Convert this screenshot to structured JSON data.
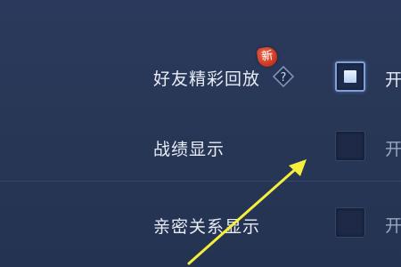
{
  "settings": {
    "rows": [
      {
        "label": "好友精彩回放",
        "checked": true,
        "option_label": "开"
      },
      {
        "label": "战绩显示",
        "checked": false,
        "option_label": "开"
      },
      {
        "label": "亲密关系显示",
        "checked": false,
        "option_label": "开"
      }
    ],
    "new_badge": "新",
    "help_icon": "question-diamond-icon"
  },
  "annotation": {
    "arrow_color": "#f3ef3a"
  }
}
